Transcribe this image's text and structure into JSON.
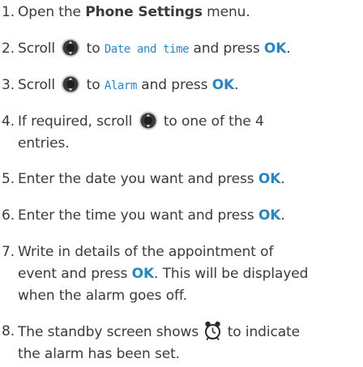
{
  "steps": [
    {
      "number": "1.",
      "parts": [
        "Open the ",
        "Phone Settings",
        " menu."
      ]
    },
    {
      "number": "2.",
      "parts": [
        "Scroll",
        "to",
        "Date and time",
        "and press",
        "OK",
        "."
      ]
    },
    {
      "number": "3.",
      "parts": [
        "Scroll",
        "to",
        "Alarm",
        "and press",
        "OK",
        "."
      ]
    },
    {
      "number": "4.",
      "lines": [
        "If required, scroll",
        "to one of the 4",
        "entries."
      ]
    },
    {
      "number": "5.",
      "parts": [
        "Enter the date you want and press ",
        "OK",
        "."
      ]
    },
    {
      "number": "6.",
      "parts": [
        "Enter the time you want and press ",
        "OK",
        "."
      ]
    },
    {
      "number": "7.",
      "lines": [
        "Write in details of the appointment of",
        "event and press ",
        "OK",
        ". This will be displayed",
        "when the alarm goes off."
      ]
    },
    {
      "number": "8.",
      "lines": [
        "The standby screen shows",
        "to indicate",
        "the alarm has been set."
      ]
    }
  ],
  "icons": {
    "nav": "navigation-key-icon",
    "clock": "alarm-clock-icon"
  },
  "colors": {
    "text": "#3a3a3a",
    "accent": "#2a86c3"
  }
}
